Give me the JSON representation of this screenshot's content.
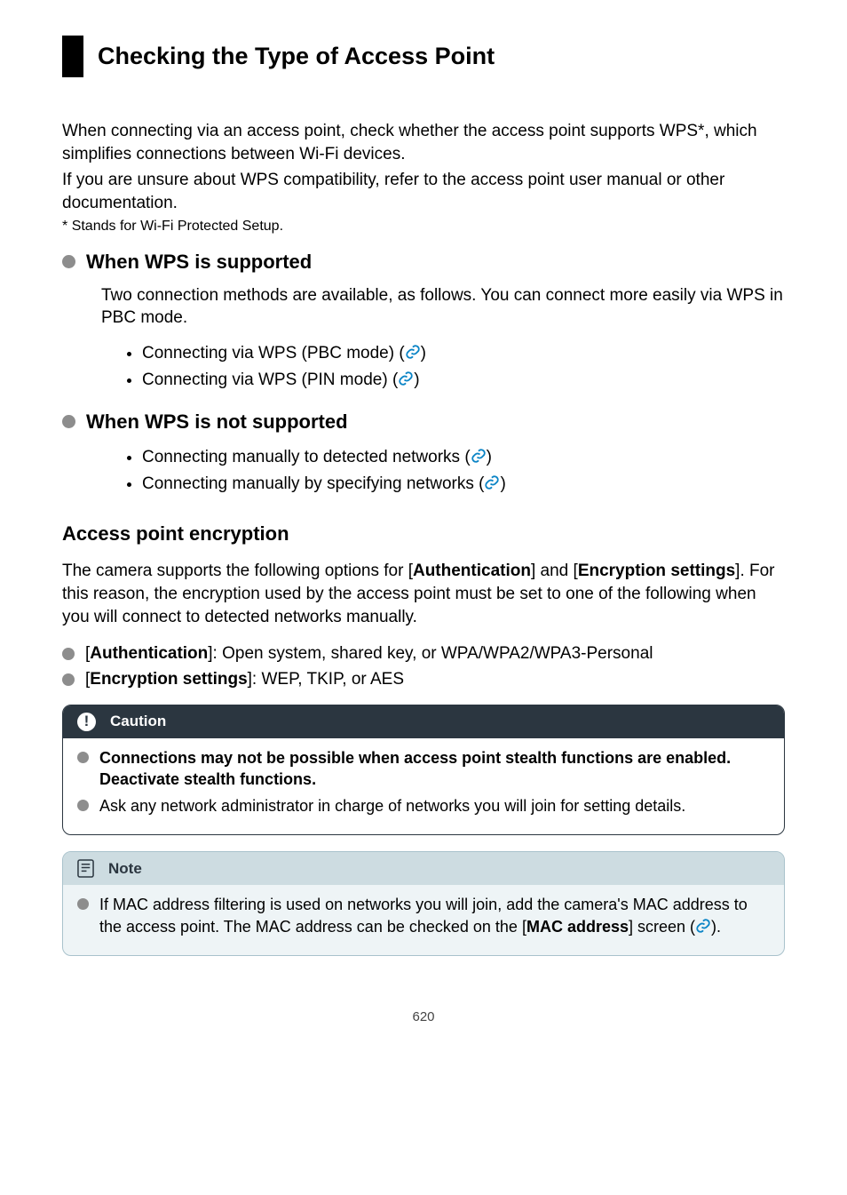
{
  "title": "Checking the Type of Access Point",
  "intro": {
    "p1": "When connecting via an access point, check whether the access point supports WPS*, which simplifies connections between Wi-Fi devices.",
    "p2": "If you are unsure about WPS compatibility, refer to the access point user manual or other documentation."
  },
  "footnote_marker": "*",
  "footnote_text": "Stands for Wi-Fi Protected Setup.",
  "section_supported": {
    "heading": "When WPS is supported",
    "desc": "Two connection methods are available, as follows. You can connect more easily via WPS in PBC mode.",
    "items": [
      "Connecting via WPS (PBC mode) (",
      "Connecting via WPS (PIN mode) ("
    ]
  },
  "section_not_supported": {
    "heading": "When WPS is not supported",
    "items": [
      "Connecting manually to detected networks (",
      "Connecting manually by specifying networks ("
    ]
  },
  "close_paren": ")",
  "encryption": {
    "heading": "Access point encryption",
    "desc_pre": "The camera supports the following options for [",
    "auth": "Authentication",
    "desc_mid1": "] and [",
    "enc": "Encryption settings",
    "desc_mid2": "]. For this reason, the encryption used by the access point must be set to one of the following when you will connect to detected networks manually.",
    "bullets": {
      "auth_label": "Authentication",
      "auth_text": "]: Open system, shared key, or WPA/WPA2/WPA3-Personal",
      "enc_label": "Encryption settings",
      "enc_text": "]: WEP, TKIP, or AES",
      "open_bracket": "["
    }
  },
  "caution": {
    "label": "Caution",
    "items": [
      "Connections may not be possible when access point stealth functions are enabled. Deactivate stealth functions.",
      "Ask any network administrator in charge of networks you will join for setting details."
    ]
  },
  "note": {
    "label": "Note",
    "text_pre": "If MAC address filtering is used on networks you will join, add the camera's MAC address to the access point. The MAC address can be checked on the [",
    "mac_label": "MAC address",
    "text_mid": "] screen ("
  },
  "page_number": "620"
}
